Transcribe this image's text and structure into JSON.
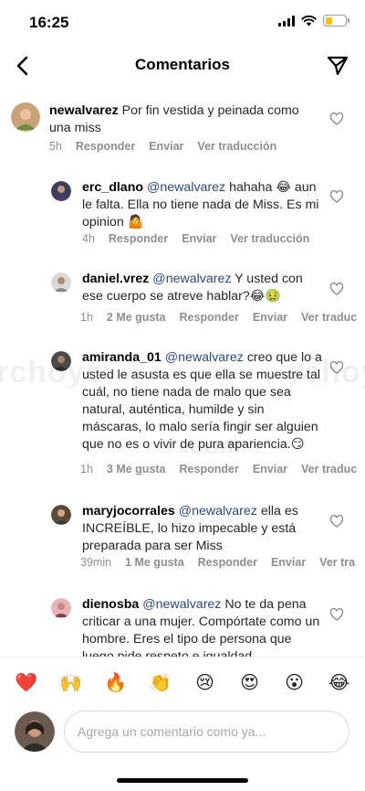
{
  "status": {
    "time": "16:25"
  },
  "nav": {
    "title": "Comentarios"
  },
  "caption": {
    "username": "newalvarez",
    "text": " Por fin vestida y peinada como una miss",
    "time": "5h",
    "reply": "Responder",
    "send": "Enviar",
    "translate": "Ver traducción"
  },
  "comments": [
    {
      "username": "erc_dlano",
      "mention": "@newalvarez",
      "text": " hahaha 😂 aun le falta. Ella no tiene nada de Miss. Es mi opinion 🤷",
      "time": "4h",
      "likes": "",
      "reply": "Responder",
      "send": "Enviar",
      "translate": "Ver traducción"
    },
    {
      "username": "daniel.vrez",
      "mention": "@newalvarez",
      "text": " Y usted con ese cuerpo se atreve hablar?😂🤢",
      "time": "1h",
      "likes": "2 Me gusta",
      "reply": "Responder",
      "send": "Enviar",
      "translate": "Ver traduc"
    },
    {
      "username": "amiranda_01",
      "mention": "@newalvarez",
      "text": " creo que lo a usted le asusta es que ella se muestre tal cuál, no tiene nada de malo que sea natural, auténtica, humilde y sin máscaras, lo malo sería fingir ser alguien que no es o vivir de pura apariencia.😏",
      "time": "1h",
      "likes": "3 Me gusta",
      "reply": "Responder",
      "send": "Enviar",
      "translate": "Ver traduc"
    },
    {
      "username": "maryjocorrales",
      "mention": "@newalvarez",
      "text": " ella es INCREÍBLE, lo hizo impecable y está preparada para ser Miss",
      "time": "39min",
      "likes": "1 Me gusta",
      "reply": "Responder",
      "send": "Enviar",
      "translate": "Ver tra"
    },
    {
      "username": "dienosba",
      "mention": "@newalvarez",
      "text": " No te da pena criticar a una mujer. Compórtate como un hombre. Eres el tipo de persona que luego pide respeto e igualdad",
      "time": "",
      "likes": "",
      "reply": "",
      "send": "",
      "translate": ""
    }
  ],
  "watermark": {
    "left": "rchoyc",
    "right": "rchoyc",
    "center": ".com"
  },
  "emoji_bar": [
    "❤️",
    "🙌",
    "🔥",
    "👏",
    "😢",
    "😍",
    "😮",
    "😂"
  ],
  "input": {
    "placeholder": "Agrega un comentario como ya..."
  },
  "colors": {
    "mention": "#2b4a7a",
    "meta": "#8e8e8e",
    "battery": "#f5c400"
  }
}
